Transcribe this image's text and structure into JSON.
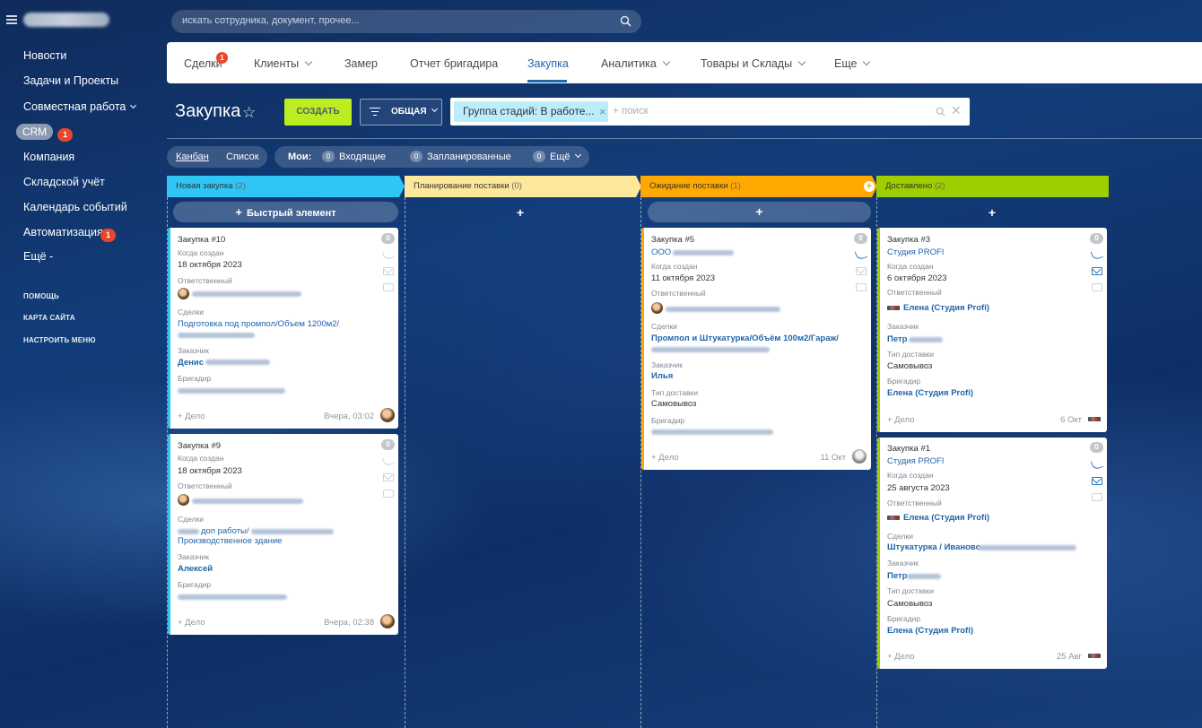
{
  "search": {
    "placeholder": "искать сотрудника, документ, прочее..."
  },
  "sidebar": {
    "items": [
      {
        "label": "Новости"
      },
      {
        "label": "Задачи и Проекты"
      },
      {
        "label": "Совместная работа"
      },
      {
        "label": "CRM",
        "badge": "1"
      },
      {
        "label": "Компания"
      },
      {
        "label": "Складской учёт"
      },
      {
        "label": "Календарь событий"
      },
      {
        "label": "Автоматизация",
        "badge": "1"
      },
      {
        "label": "Ещё -"
      }
    ],
    "small_links": [
      "ПОМОЩЬ",
      "КАРТА САЙТА",
      "НАСТРОИТЬ МЕНЮ"
    ]
  },
  "tabs": [
    {
      "label": "Сделки",
      "badge": "1"
    },
    {
      "label": "Клиенты"
    },
    {
      "label": "Замер"
    },
    {
      "label": "Отчет бригадира"
    },
    {
      "label": "Закупка",
      "active": true
    },
    {
      "label": "Аналитика"
    },
    {
      "label": "Товары и Склады"
    },
    {
      "label": "Еще"
    }
  ],
  "page": {
    "title": "Закупка",
    "create_button": "СОЗДАТЬ",
    "filter_button": "ОБЩАЯ",
    "filter_chip": "Группа стадий: В работе...",
    "filter_placeholder": "+ поиск"
  },
  "view": {
    "kanban": "Канбан",
    "list": "Список",
    "mine": "Мои:",
    "incoming": {
      "label": "Входящие",
      "count": "0"
    },
    "planned": {
      "label": "Запланированные",
      "count": "0"
    },
    "more": {
      "label": "Ещё",
      "count": "0"
    }
  },
  "columns": [
    {
      "title": "Новая закупка",
      "count": "(2)",
      "color": "#2fc6f6"
    },
    {
      "title": "Планирование поставки",
      "count": "(0)",
      "color": "#fbe89b"
    },
    {
      "title": "Ожидание поставки",
      "count": "(1)",
      "color": "#ffa900"
    },
    {
      "title": "Доставлено",
      "count": "(2)",
      "color": "#9dcf00"
    }
  ],
  "quick_add": "Быстрый элемент",
  "labels": {
    "created": "Когда создан",
    "responsible": "Ответственный",
    "deals": "Сделки",
    "customer": "Заказчик",
    "foreman": "Бригадир",
    "delivery_type": "Тип доставки",
    "add_task": "+ Дело"
  },
  "cards": {
    "c10": {
      "title": "Закупка #10",
      "date": "18 октября 2023",
      "deal": "Подготовка под промпол/Объем 1200м2/",
      "customer": "Денис",
      "footer": "Вчера, 03:02",
      "count": "0"
    },
    "c9": {
      "title": "Закупка #9",
      "date": "18 октября 2023",
      "deal_part": "доп работы/",
      "deal_line2": "Производственное здание",
      "customer": "Алексей",
      "footer": "Вчера, 02:38",
      "count": "0"
    },
    "c5": {
      "title": "Закупка #5",
      "company": "ООО",
      "date": "11 октября 2023",
      "deal": "Промпол и Штукатурка/Объём 100м2/Гараж/",
      "customer": "Илья",
      "delivery": "Самовывоз",
      "footer": "11 Окт",
      "count": "0"
    },
    "c3": {
      "title": "Закупка #3",
      "company": "Студия PROFI",
      "date": "6 октября 2023",
      "responsible": "Елена (Студия Profi)",
      "customer": "Петр",
      "delivery": "Самовывоз",
      "foreman": "Елена (Студия Profi)",
      "footer": "6 Окт",
      "count": "0"
    },
    "c1": {
      "title": "Закупка #1",
      "company": "Студия PROFI",
      "date": "25 августа 2023",
      "responsible": "Елена (Студия Profi)",
      "deal": "Штукатурка / Иваново",
      "customer": "Петр",
      "delivery": "Самовывоз",
      "foreman": "Елена (Студия Profi)",
      "footer": "25 Авг",
      "count": "0"
    }
  }
}
